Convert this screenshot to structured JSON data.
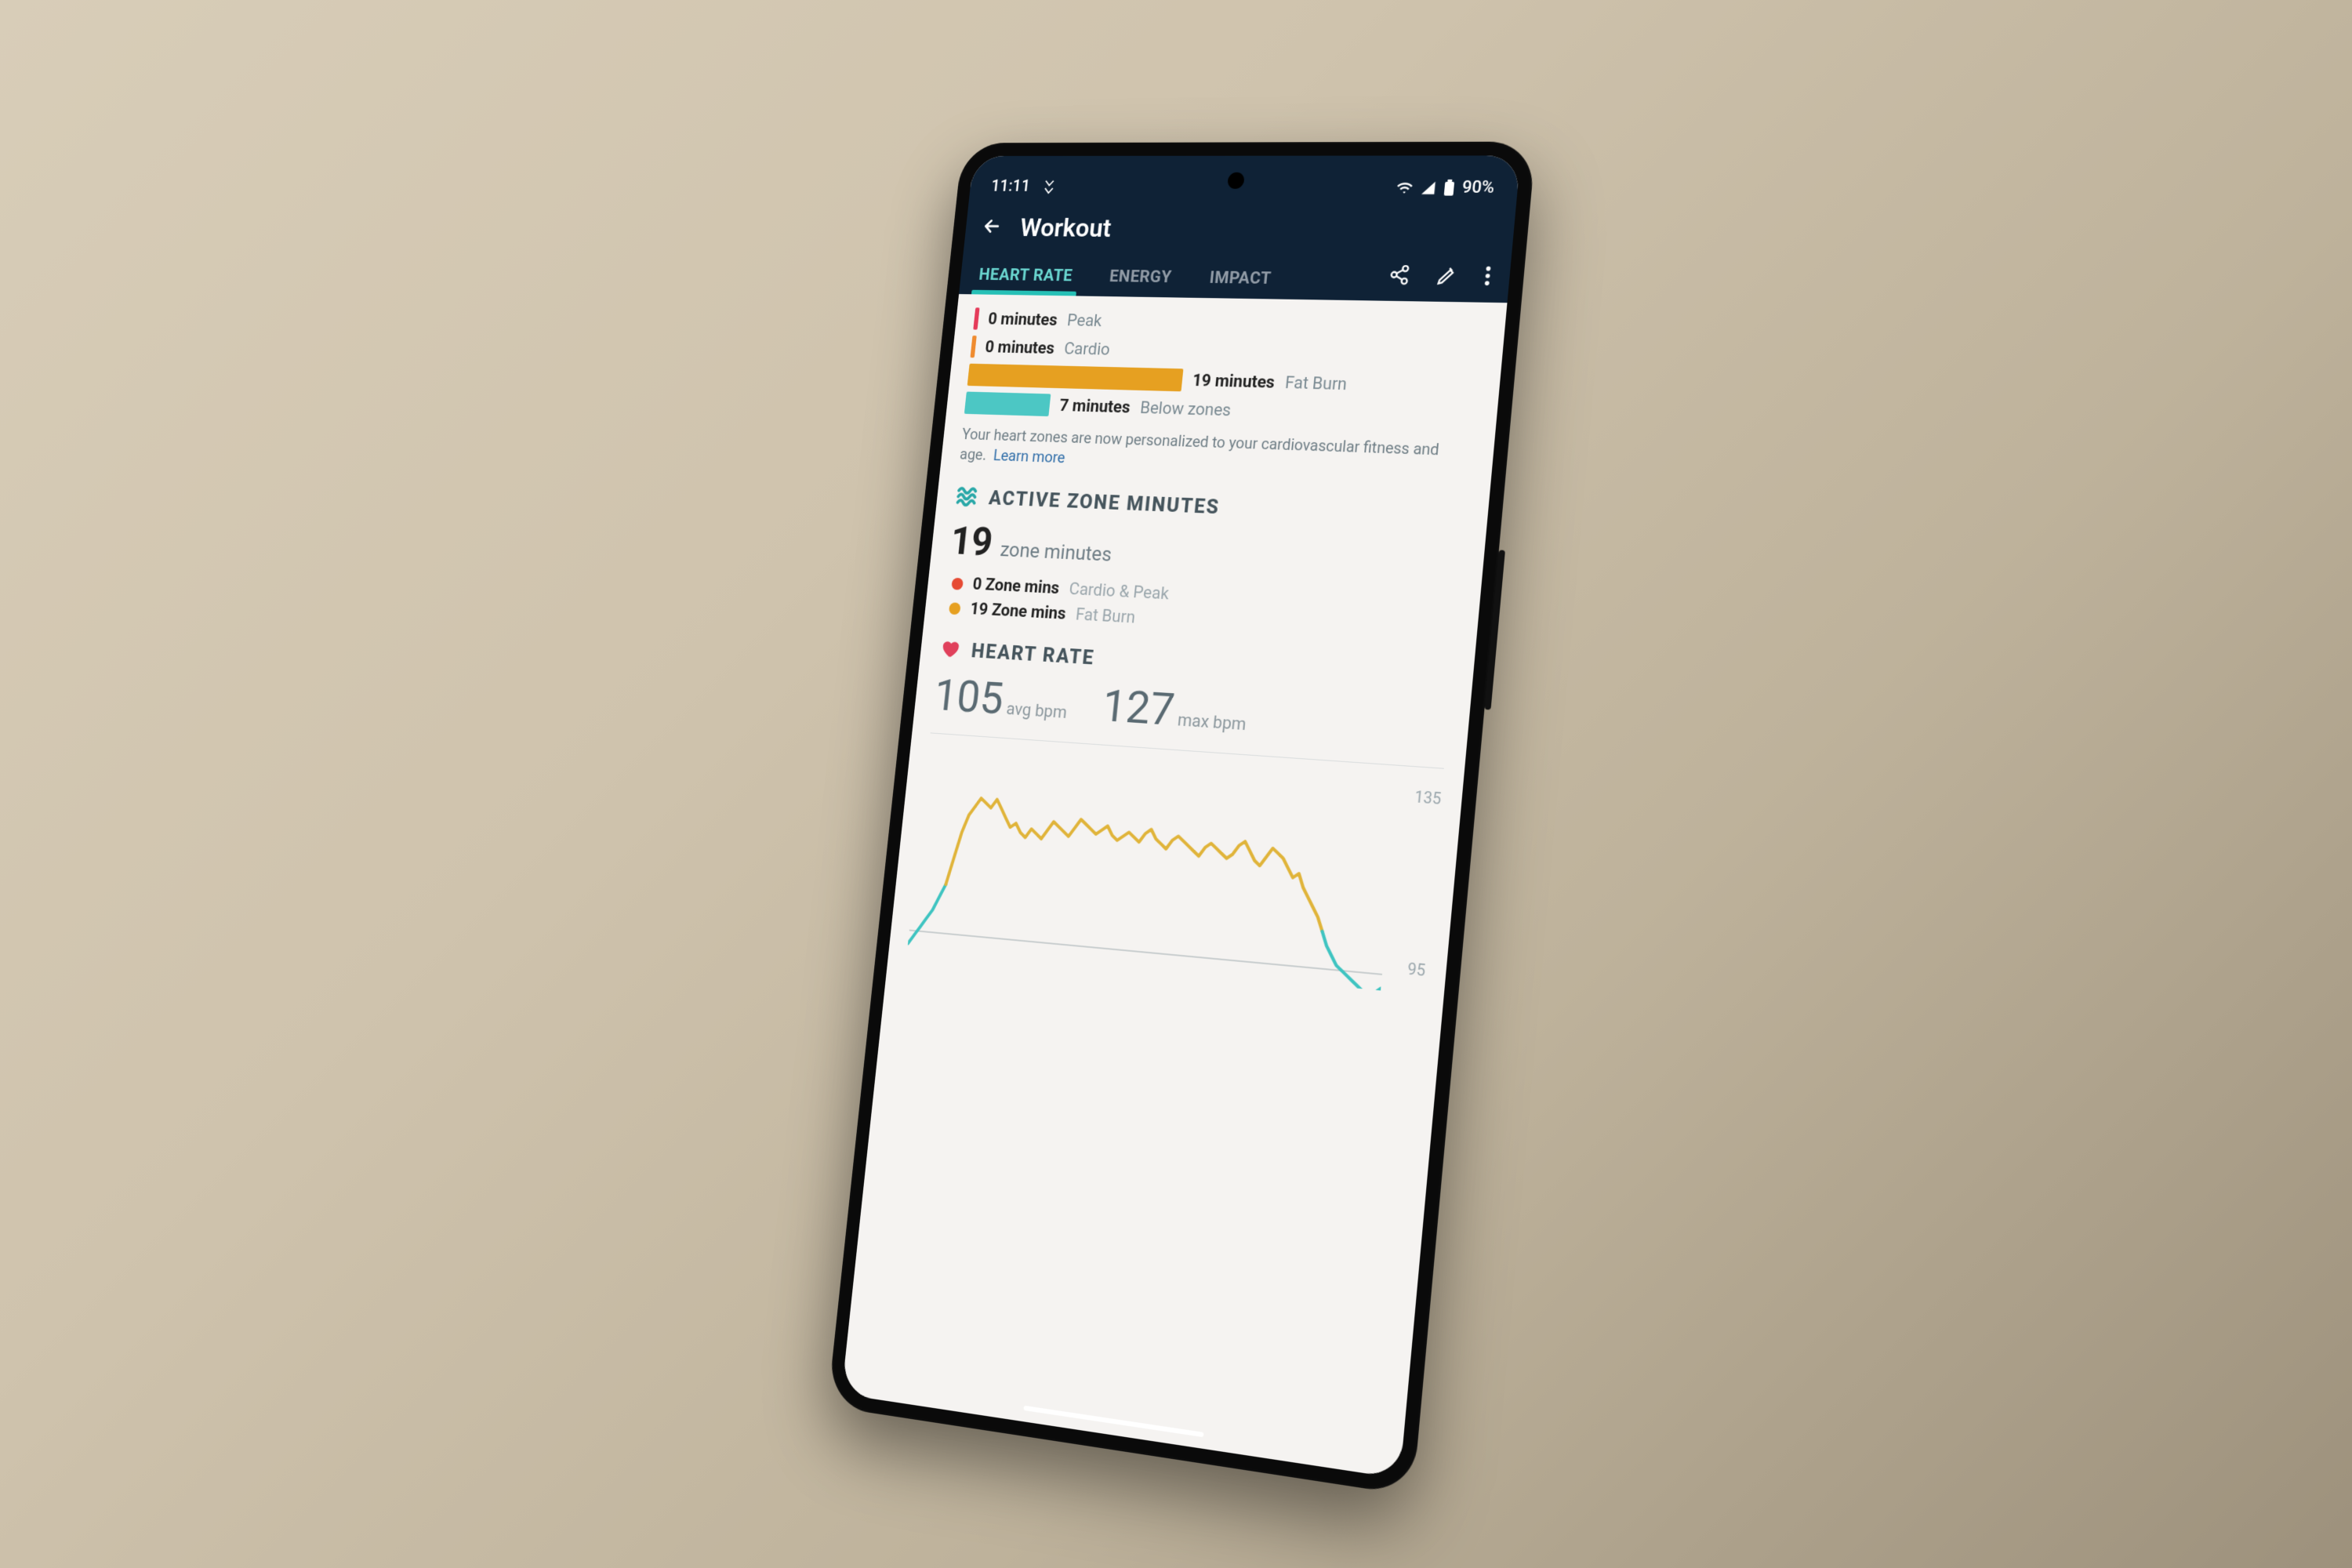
{
  "statusbar": {
    "time": "11:11",
    "battery_pct": "90%"
  },
  "appbar": {
    "title": "Workout"
  },
  "tabs": {
    "heart_rate": "HEART RATE",
    "energy": "ENERGY",
    "impact": "IMPACT"
  },
  "zones": {
    "peak": {
      "value": "0 minutes",
      "label": "Peak"
    },
    "cardio": {
      "value": "0 minutes",
      "label": "Cardio"
    },
    "fat": {
      "value": "19 minutes",
      "label": "Fat Burn"
    },
    "below": {
      "value": "7 minutes",
      "label": "Below zones"
    }
  },
  "note_text": "Your heart zones are now personalized to your cardiovascular fitness and age.",
  "note_link": "Learn more",
  "active_zone": {
    "heading": "ACTIVE ZONE MINUTES",
    "total_num": "19",
    "total_label": "zone minutes",
    "items": [
      {
        "value": "0 Zone mins",
        "label": "Cardio & Peak"
      },
      {
        "value": "19 Zone mins",
        "label": "Fat Burn"
      }
    ]
  },
  "heart_rate": {
    "heading": "HEART RATE",
    "avg_num": "105",
    "avg_label": "avg bpm",
    "max_num": "127",
    "max_label": "max bpm",
    "y_top": "135",
    "y_bot": "95"
  },
  "chart_data": {
    "type": "line",
    "title": "Heart Rate",
    "xlabel": "",
    "ylabel": "bpm",
    "ylim": [
      95,
      135
    ],
    "annotations": [
      135,
      95
    ],
    "series": [
      {
        "name": "bpm",
        "color_rule": "teal <105, yellow 105-135",
        "values": [
          92,
          94,
          96,
          98,
          100,
          103,
          106,
          112,
          118,
          122,
          124,
          126,
          125,
          124,
          126,
          124,
          122,
          120,
          121,
          119,
          118,
          120,
          119,
          118,
          120,
          122,
          121,
          120,
          119,
          121,
          123,
          122,
          121,
          120,
          121,
          122,
          120,
          119,
          120,
          121,
          120,
          119,
          121,
          122,
          120,
          119,
          118,
          120,
          121,
          120,
          119,
          118,
          117,
          119,
          120,
          119,
          118,
          117,
          118,
          120,
          121,
          119,
          117,
          116,
          118,
          120,
          119,
          118,
          116,
          114,
          115,
          112,
          110,
          108,
          106,
          103,
          100,
          98,
          96,
          95,
          94,
          93,
          92,
          91,
          90,
          91,
          92
        ]
      }
    ]
  }
}
